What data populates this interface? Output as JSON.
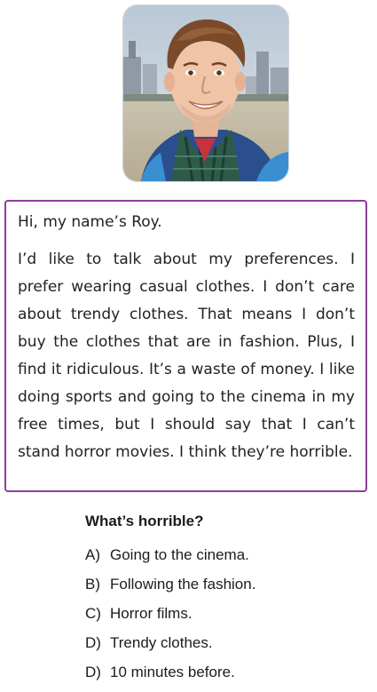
{
  "passage": {
    "greeting": "Hi, my name’s Roy.",
    "text": "I’d like to talk about my preferences. I prefer wearing casual clothes. I don’t care about trendy clothes. That means I don’t buy the clothes that are in fashion. Plus, I find it ridiculous. It’s a waste of money. I like doing sports and going to the cinema in my free times, but I should say that I can’t stand horror movies. I think they’re horrible."
  },
  "quiz": {
    "question": "What’s horrible?",
    "options": [
      {
        "letter": "A)",
        "text": "Going to the cinema."
      },
      {
        "letter": "B)",
        "text": "Following the fashion."
      },
      {
        "letter": "C)",
        "text": "Horror films."
      },
      {
        "letter": "D)",
        "text": "Trendy clothes."
      },
      {
        "letter": "D)",
        "text": "10 minutes before."
      }
    ]
  },
  "colors": {
    "border": "#8c3d9a",
    "text": "#222222"
  }
}
